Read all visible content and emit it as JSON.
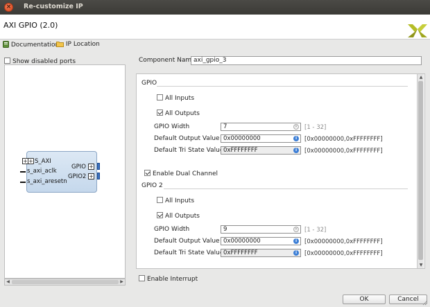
{
  "window": {
    "title": "Re-customize IP",
    "close_glyph": "×"
  },
  "header": {
    "ip_title": "AXI GPIO (2.0)"
  },
  "links": {
    "documentation": "Documentation",
    "ip_location": "IP Location"
  },
  "left_panel": {
    "show_disabled_ports": "Show disabled ports",
    "show_disabled_checked": false,
    "block": {
      "ports_left": [
        "S_AXI",
        "s_axi_aclk",
        "s_axi_aresetn"
      ],
      "ports_right": [
        "GPIO",
        "GPIO2"
      ]
    }
  },
  "component": {
    "label": "Component Name",
    "value": "axi_gpio_3"
  },
  "gpio": {
    "section": "GPIO",
    "all_inputs": "All Inputs",
    "all_inputs_checked": false,
    "all_outputs": "All Outputs",
    "all_outputs_checked": true,
    "width_label": "GPIO Width",
    "width_value": "7",
    "width_range": "[1 - 32]",
    "default_output_label": "Default Output Value",
    "default_output_value": "0x00000000",
    "default_output_range": "[0x00000000,0xFFFFFFFF]",
    "default_tri_label": "Default Tri State Value",
    "default_tri_value": "0xFFFFFFFF",
    "default_tri_range": "[0x00000000,0xFFFFFFFF]"
  },
  "dual": {
    "label": "Enable Dual Channel",
    "checked": true
  },
  "gpio2": {
    "section": "GPIO 2",
    "all_inputs": "All Inputs",
    "all_inputs_checked": false,
    "all_outputs": "All Outputs",
    "all_outputs_checked": true,
    "width_label": "GPIO Width",
    "width_value": "9",
    "width_range": "[1 - 32]",
    "default_output_label": "Default Output Value",
    "default_output_value": "0x00000000",
    "default_output_range": "[0x00000000,0xFFFFFFFF]",
    "default_tri_label": "Default Tri State Value",
    "default_tri_value": "0xFFFFFFFF",
    "default_tri_range": "[0x00000000,0xFFFFFFFF]"
  },
  "interrupt": {
    "label": "Enable Interrupt",
    "checked": false
  },
  "buttons": {
    "ok": "OK",
    "cancel": "Cancel"
  },
  "icons": {
    "close": "close-icon",
    "logo": "xilinx-logo-icon",
    "documentation": "documentation-icon",
    "ip_location": "folder-icon",
    "info": "info-icon",
    "clear": "clear-icon"
  },
  "colors": {
    "titlebar": "#3f3e3a",
    "close": "#e2541f",
    "logo": "#b5bd26",
    "block": "#c9dbee",
    "info": "#3d7fd6"
  }
}
